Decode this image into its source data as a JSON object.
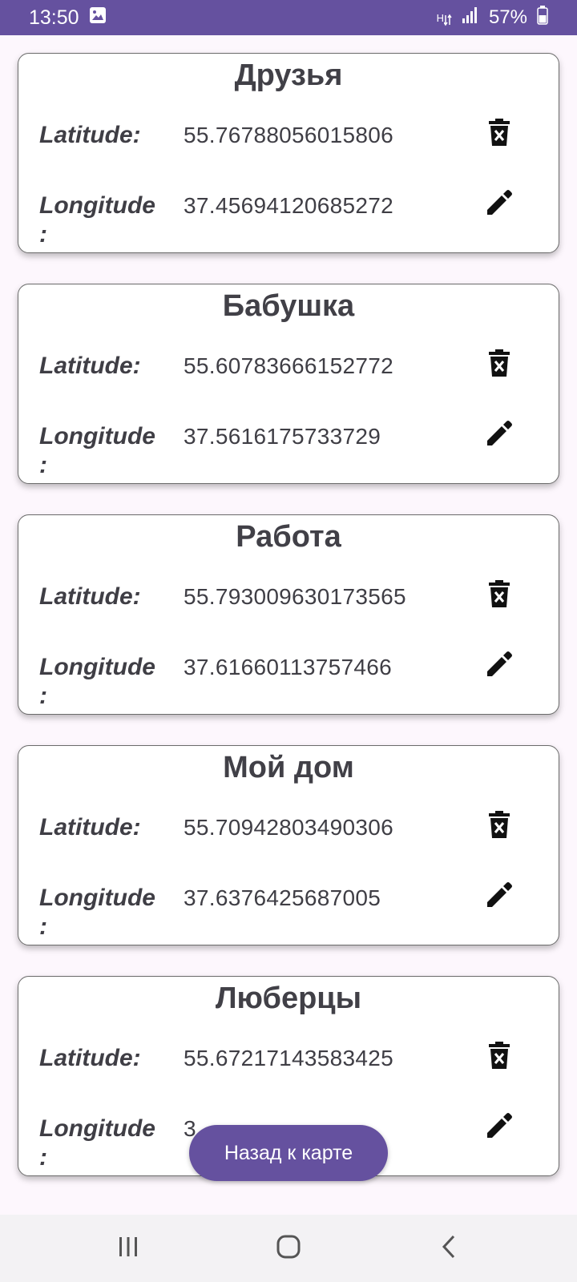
{
  "status_bar": {
    "time": "13:50",
    "network": "H",
    "battery": "57%"
  },
  "labels": {
    "latitude": "Latitude:",
    "longitude": "Longitude",
    "longitude_suffix": ":"
  },
  "places": [
    {
      "name": "Друзья",
      "latitude": "55.76788056015806",
      "longitude": "37.45694120685272"
    },
    {
      "name": "Бабушка",
      "latitude": "55.60783666152772",
      "longitude": "37.5616175733729"
    },
    {
      "name": "Работа",
      "latitude": "55.793009630173565",
      "longitude": "37.61660113757466"
    },
    {
      "name": "Мой дом",
      "latitude": "55.70942803490306",
      "longitude": "37.6376425687005"
    },
    {
      "name": "Люберцы",
      "latitude": "55.67217143583425",
      "longitude": "3"
    }
  ],
  "back_button_label": "Назад к карте",
  "colors": {
    "accent": "#65519f",
    "text": "#414047"
  },
  "icons": {
    "delete": "delete-icon",
    "edit": "edit-pencil-icon",
    "nav_recents": "recents-icon",
    "nav_home": "home-icon",
    "nav_back": "back-icon"
  }
}
